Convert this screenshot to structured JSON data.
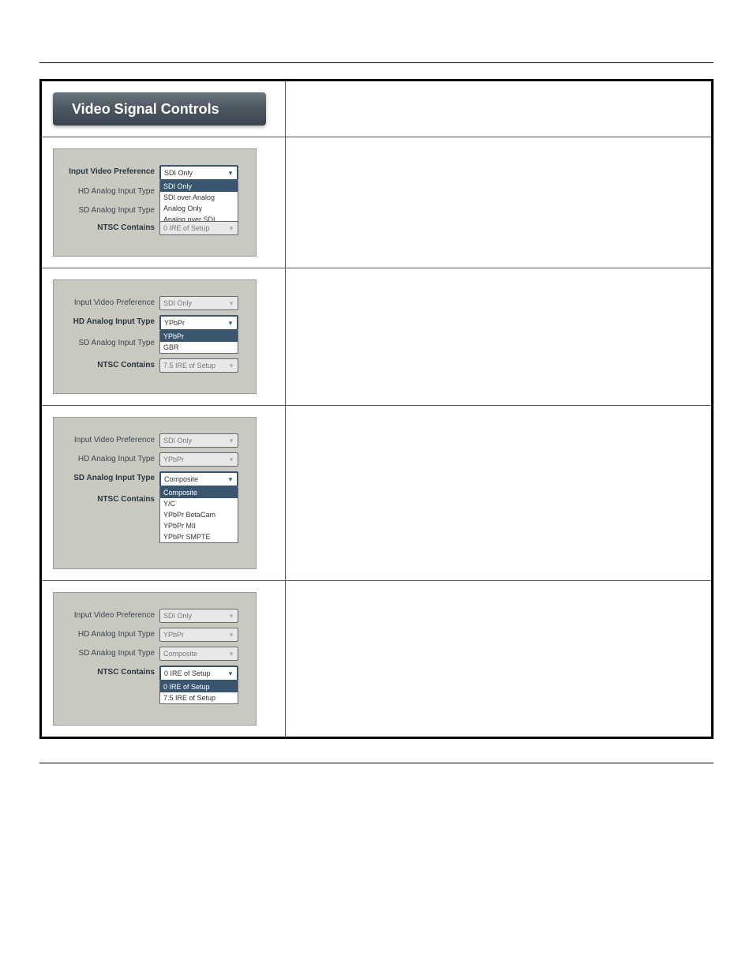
{
  "banner_title": "Video Signal Controls",
  "labels": {
    "input_video_pref": "Input Video Preference",
    "hd_analog": "HD Analog Input Type",
    "sd_analog": "SD Analog Input Type",
    "ntsc": "NTSC Contains"
  },
  "panels": [
    {
      "active_field": "input_video_pref",
      "fields": {
        "input_video_pref": {
          "value": "SDI Only",
          "active": true,
          "disabled": false,
          "expanded": true,
          "options": [
            "SDI Only",
            "SDI over Analog",
            "Analog Only",
            "Analog over SDI"
          ],
          "selected_idx": 0
        },
        "hd_analog": {
          "value": "",
          "active": false,
          "disabled": false,
          "expanded": false
        },
        "sd_analog": {
          "value": "",
          "active": false,
          "disabled": false,
          "expanded": false
        },
        "ntsc": {
          "value": "0 IRE of Setup",
          "active": false,
          "disabled": true,
          "expanded": false
        }
      }
    },
    {
      "active_field": "hd_analog",
      "fields": {
        "input_video_pref": {
          "value": "SDI Only",
          "active": false,
          "disabled": true,
          "expanded": false
        },
        "hd_analog": {
          "value": "YPbPr",
          "active": true,
          "disabled": false,
          "expanded": true,
          "options": [
            "YPbPr",
            "GBR"
          ],
          "selected_idx": 0
        },
        "sd_analog": {
          "value": "",
          "active": false,
          "disabled": false,
          "expanded": false
        },
        "ntsc": {
          "value": "7.5 IRE of Setup",
          "active": false,
          "disabled": true,
          "expanded": false
        }
      }
    },
    {
      "active_field": "sd_analog",
      "fields": {
        "input_video_pref": {
          "value": "SDI Only",
          "active": false,
          "disabled": true,
          "expanded": false
        },
        "hd_analog": {
          "value": "YPbPr",
          "active": false,
          "disabled": true,
          "expanded": false
        },
        "sd_analog": {
          "value": "Composite",
          "active": true,
          "disabled": false,
          "expanded": true,
          "options": [
            "Composite",
            "Y/C",
            "YPbPr BetaCam",
            "YPbPr MII",
            "YPbPr SMPTE"
          ],
          "selected_idx": 0
        },
        "ntsc": {
          "value": "",
          "active": false,
          "disabled": false,
          "expanded": false
        }
      }
    },
    {
      "active_field": "ntsc",
      "fields": {
        "input_video_pref": {
          "value": "SDI Only",
          "active": false,
          "disabled": true,
          "expanded": false
        },
        "hd_analog": {
          "value": "YPbPr",
          "active": false,
          "disabled": true,
          "expanded": false
        },
        "sd_analog": {
          "value": "Composite",
          "active": false,
          "disabled": true,
          "expanded": false
        },
        "ntsc": {
          "value": "0 IRE of Setup",
          "active": true,
          "disabled": false,
          "expanded": true,
          "options": [
            "0 IRE of Setup",
            "7.5 IRE of Setup"
          ],
          "selected_idx": 0
        }
      }
    }
  ]
}
